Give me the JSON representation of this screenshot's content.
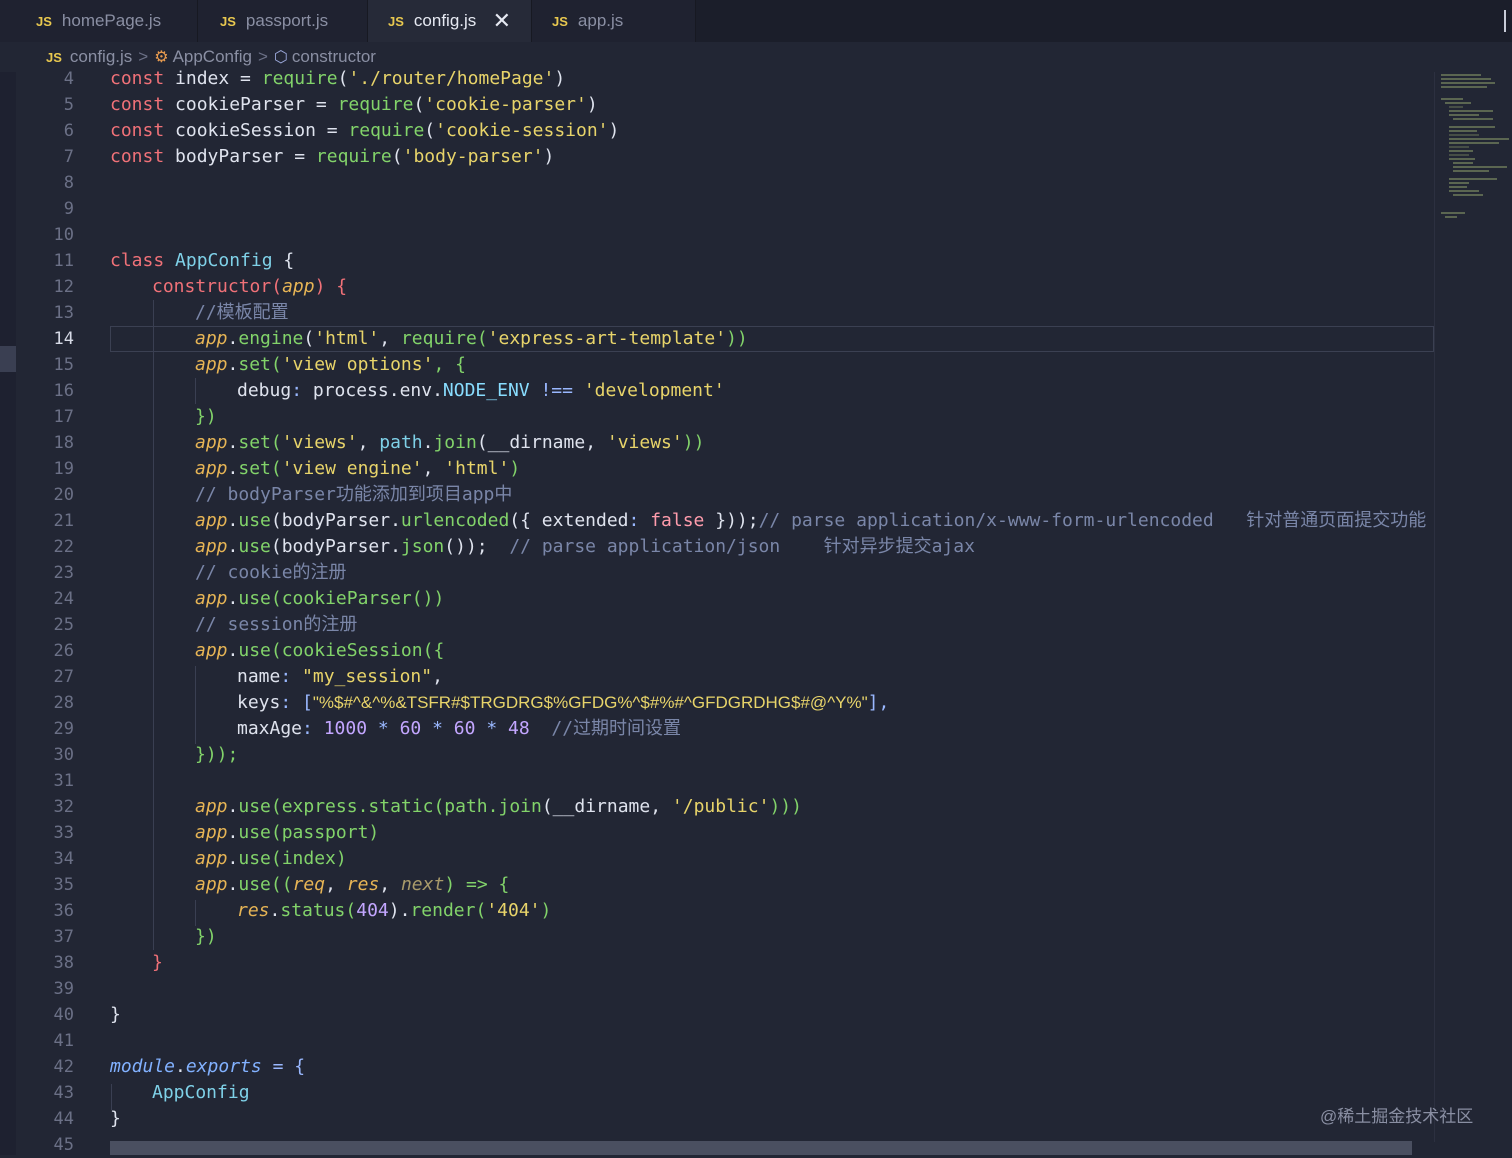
{
  "tabs": [
    {
      "icon": "JS",
      "label": "homePage.js",
      "active": false
    },
    {
      "icon": "JS",
      "label": "passport.js",
      "active": false
    },
    {
      "icon": "JS",
      "label": "config.js",
      "active": true,
      "close": "✕"
    },
    {
      "icon": "JS",
      "label": "app.js",
      "active": false
    }
  ],
  "breadcrumb": {
    "file_icon": "JS",
    "file": "config.js",
    "class_icon": "class-symbol-icon",
    "class_name": "AppConfig",
    "method_icon": "method-cube-icon",
    "method": "constructor",
    "separator": ">"
  },
  "editor": {
    "current_line": "14",
    "line_numbers": [
      "4",
      "5",
      "6",
      "7",
      "8",
      "9",
      "10",
      "11",
      "12",
      "13",
      "14",
      "15",
      "16",
      "17",
      "18",
      "19",
      "20",
      "21",
      "22",
      "23",
      "24",
      "25",
      "26",
      "27",
      "28",
      "29",
      "30",
      "31",
      "32",
      "33",
      "34",
      "35",
      "36",
      "37",
      "38",
      "39",
      "40",
      "41",
      "42",
      "43",
      "44",
      "45"
    ]
  },
  "code": {
    "l4_a": "const",
    "l4_b": " index = ",
    "l4_c": "require",
    "l4_d": "(",
    "l4_e": "'./router/homePage'",
    "l4_f": ")",
    "l5_a": "const",
    "l5_b": " cookieParser = ",
    "l5_c": "require",
    "l5_d": "(",
    "l5_e": "'cookie-parser'",
    "l5_f": ")",
    "l6_a": "const",
    "l6_b": " cookieSession = ",
    "l6_c": "require",
    "l6_d": "(",
    "l6_e": "'cookie-session'",
    "l6_f": ")",
    "l7_a": "const",
    "l7_b": " bodyParser = ",
    "l7_c": "require",
    "l7_d": "(",
    "l7_e": "'body-parser'",
    "l7_f": ")",
    "l11_a": "class",
    "l11_b": " AppConfig",
    "l11_c": " {",
    "l12_a": "constructor",
    "l12_b": "(",
    "l12_c": "app",
    "l12_d": ") {",
    "l13": "//模板配置",
    "l14_a": "app",
    "l14_b": ".",
    "l14_c": "engine",
    "l14_d": "(",
    "l14_e": "'html'",
    "l14_f": ", ",
    "l14_g": "require",
    "l14_h": "(",
    "l14_i": "'express-art-template'",
    "l14_j": "))",
    "l15_a": "app",
    "l15_b": ".",
    "l15_c": "set",
    "l15_d": "(",
    "l15_e": "'view options'",
    "l15_f": ", {",
    "l16_a": "debug",
    "l16_b": ": ",
    "l16_c": "process.env.",
    "l16_d": "NODE_ENV",
    "l16_e": " !== ",
    "l16_f": "'development'",
    "l17": "})",
    "l18_a": "app",
    "l18_b": ".",
    "l18_c": "set",
    "l18_d": "(",
    "l18_e": "'views'",
    "l18_f": ", ",
    "l18_g": "path",
    "l18_h": ".",
    "l18_i": "join",
    "l18_j": "(__dirname, ",
    "l18_k": "'views'",
    "l18_l": "))",
    "l19_a": "app",
    "l19_b": ".",
    "l19_c": "set",
    "l19_d": "(",
    "l19_e": "'view engine'",
    "l19_f": ", ",
    "l19_g": "'html'",
    "l19_h": ")",
    "l20": "// bodyParser功能添加到项目app中",
    "l21_a": "app",
    "l21_b": ".",
    "l21_c": "use",
    "l21_d": "(bodyParser.",
    "l21_e": "urlencoded",
    "l21_f": "({ extended",
    "l21_g": ": ",
    "l21_h": "false",
    "l21_i": " }));",
    "l21_j": "// parse application/x-www-form-urlencoded   针对普通页面提交功能",
    "l22_a": "app",
    "l22_b": ".",
    "l22_c": "use",
    "l22_d": "(bodyParser.",
    "l22_e": "json",
    "l22_f": "());  ",
    "l22_g": "// parse application/json    针对异步提交ajax",
    "l23": "// cookie的注册",
    "l24_a": "app",
    "l24_b": ".",
    "l24_c": "use",
    "l24_d": "(",
    "l24_e": "cookieParser",
    "l24_f": "())",
    "l25": "// session的注册",
    "l26_a": "app",
    "l26_b": ".",
    "l26_c": "use",
    "l26_d": "(",
    "l26_e": "cookieSession",
    "l26_f": "({",
    "l27_a": "name",
    "l27_b": ": ",
    "l27_c": "\"my_session\"",
    "l27_d": ",",
    "l28_a": "keys",
    "l28_b": ": [",
    "l28_c": "\"%$#^&^%&TSFR#$TRGDRG$%GFDG%^$#%#^GFDGRDHG$#@^Y%\"",
    "l28_d": "],",
    "l29_a": "maxAge",
    "l29_b": ": ",
    "l29_c": "1000",
    "l29_d": " * ",
    "l29_e": "60",
    "l29_f": " * ",
    "l29_g": "60",
    "l29_h": " * ",
    "l29_i": "48",
    "l29_j": "  //过期时间设置",
    "l30": "}));",
    "l32_a": "app",
    "l32_b": ".",
    "l32_c": "use",
    "l32_d": "(express.",
    "l32_e": "static",
    "l32_f": "(path.",
    "l32_g": "join",
    "l32_h": "(__dirname, ",
    "l32_i": "'/public'",
    "l32_j": ")))",
    "l33_a": "app",
    "l33_b": ".",
    "l33_c": "use",
    "l33_d": "(passport)",
    "l34_a": "app",
    "l34_b": ".",
    "l34_c": "use",
    "l34_d": "(index)",
    "l35_a": "app",
    "l35_b": ".",
    "l35_c": "use",
    "l35_d": "((",
    "l35_e": "req",
    "l35_f": ", ",
    "l35_g": "res",
    "l35_h": ", ",
    "l35_i": "next",
    "l35_j": ") => {",
    "l36_a": "res",
    "l36_b": ".",
    "l36_c": "status",
    "l36_d": "(",
    "l36_e": "404",
    "l36_f": ").",
    "l36_g": "render",
    "l36_h": "(",
    "l36_i": "'404'",
    "l36_j": ")",
    "l37": "})",
    "l38": "}",
    "l40": "}",
    "l42_a": "module",
    "l42_b": ".",
    "l42_c": "exports",
    "l42_d": " = {",
    "l43": "AppConfig",
    "l44": "}"
  },
  "watermark": "@稀土掘金技术社区",
  "colors": {
    "background": "#222634",
    "keyword": "#f07178",
    "function": "#82d36a",
    "string": "#e8d46a",
    "variable": "#e6b455",
    "comment": "#7a86a8",
    "number": "#c3a6ff"
  }
}
